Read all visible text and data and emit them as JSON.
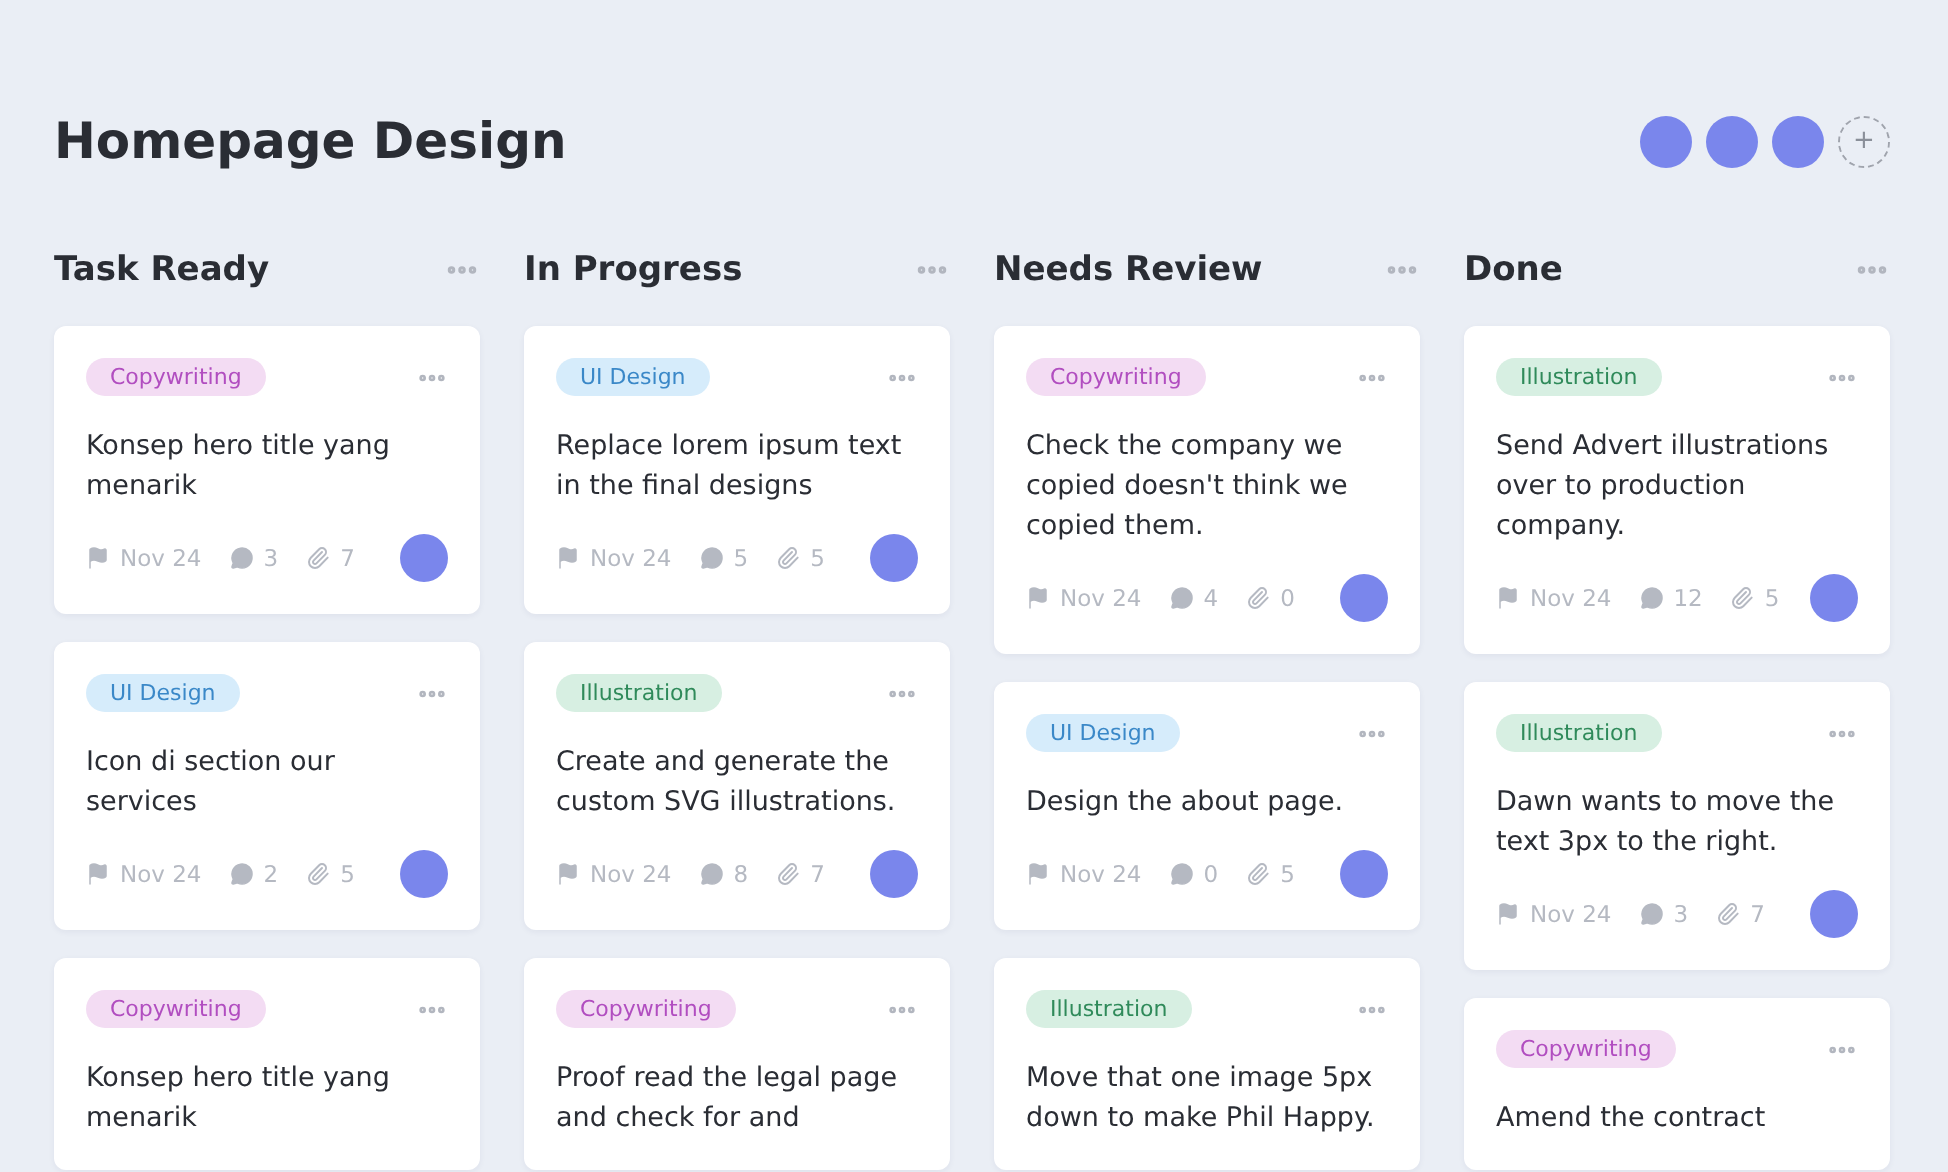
{
  "board": {
    "title": "Homepage Design",
    "members": [
      {
        "kind": "avatar"
      },
      {
        "kind": "avatar"
      },
      {
        "kind": "avatar"
      },
      {
        "kind": "add",
        "label": "+"
      }
    ]
  },
  "columns": [
    {
      "title": "Task Ready",
      "cards": [
        {
          "tag": {
            "label": "Copywriting",
            "kind": "copywriting"
          },
          "text": "Konsep hero title yang menarik",
          "meta": {
            "date": "Nov 24",
            "comments": "3",
            "attachments": "7"
          }
        },
        {
          "tag": {
            "label": "UI Design",
            "kind": "ui"
          },
          "text": "Icon di section our services",
          "meta": {
            "date": "Nov 24",
            "comments": "2",
            "attachments": "5"
          }
        },
        {
          "tag": {
            "label": "Copywriting",
            "kind": "copywriting"
          },
          "text": "Konsep hero title yang menarik"
        }
      ]
    },
    {
      "title": "In Progress",
      "cards": [
        {
          "tag": {
            "label": "UI Design",
            "kind": "ui"
          },
          "text": "Replace lorem ipsum text in the final designs",
          "meta": {
            "date": "Nov 24",
            "comments": "5",
            "attachments": "5"
          }
        },
        {
          "tag": {
            "label": "Illustration",
            "kind": "illustration"
          },
          "text": "Create and generate the custom SVG illustrations.",
          "meta": {
            "date": "Nov 24",
            "comments": "8",
            "attachments": "7"
          }
        },
        {
          "tag": {
            "label": "Copywriting",
            "kind": "copywriting"
          },
          "text": "Proof read the legal page and check for and"
        }
      ]
    },
    {
      "title": "Needs Review",
      "cards": [
        {
          "tag": {
            "label": "Copywriting",
            "kind": "copywriting"
          },
          "text": "Check the company we copied doesn't think we copied them.",
          "meta": {
            "date": "Nov 24",
            "comments": "4",
            "attachments": "0"
          }
        },
        {
          "tag": {
            "label": "UI Design",
            "kind": "ui"
          },
          "text": "Design the about page.",
          "meta": {
            "date": "Nov 24",
            "comments": "0",
            "attachments": "5"
          }
        },
        {
          "tag": {
            "label": "Illustration",
            "kind": "illustration"
          },
          "text": "Move that one image 5px down to make Phil Happy."
        }
      ]
    },
    {
      "title": "Done",
      "cards": [
        {
          "tag": {
            "label": "Illustration",
            "kind": "illustration"
          },
          "text": "Send Advert illustrations over to production company.",
          "meta": {
            "date": "Nov 24",
            "comments": "12",
            "attachments": "5"
          }
        },
        {
          "tag": {
            "label": "Illustration",
            "kind": "illustration"
          },
          "text": "Dawn wants to move the text 3px to the right.",
          "meta": {
            "date": "Nov 24",
            "comments": "3",
            "attachments": "7"
          }
        },
        {
          "tag": {
            "label": "Copywriting",
            "kind": "copywriting"
          },
          "text": "Amend the contract"
        }
      ]
    }
  ]
}
